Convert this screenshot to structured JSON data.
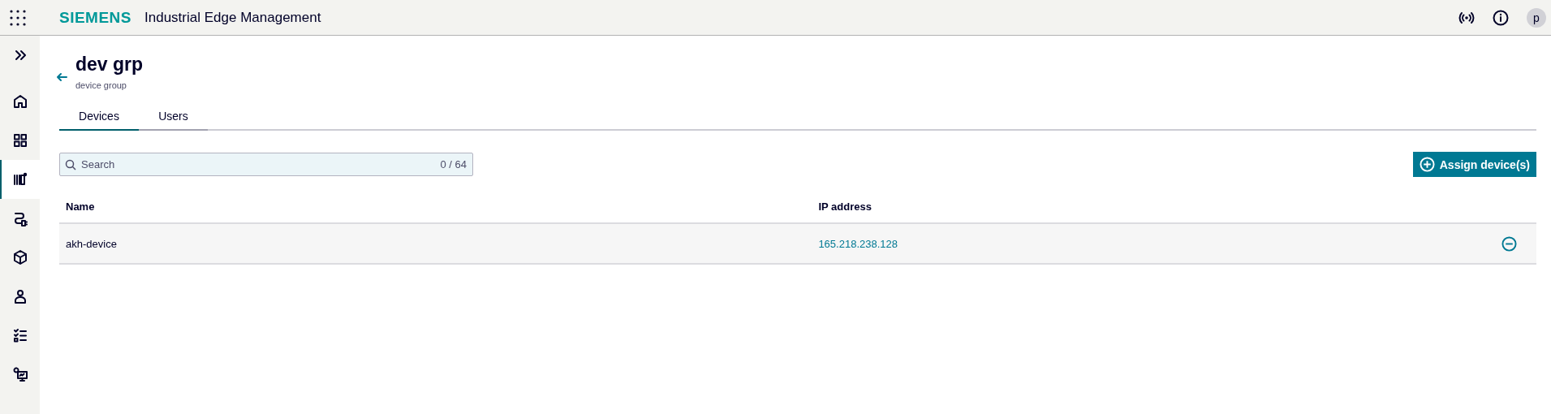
{
  "header": {
    "brand": "SIEMENS",
    "app_title": "Industrial Edge Management",
    "avatar": "p"
  },
  "sidebar": {
    "items": [
      {
        "selected": false
      },
      {
        "selected": false
      },
      {
        "selected": true
      },
      {
        "selected": false
      },
      {
        "selected": false
      },
      {
        "selected": false
      },
      {
        "selected": false
      },
      {
        "selected": false
      }
    ]
  },
  "page": {
    "title": "dev grp",
    "subtitle": "device group"
  },
  "tabs": [
    {
      "label": "Devices",
      "selected": true
    },
    {
      "label": "Users",
      "selected": false
    }
  ],
  "search": {
    "placeholder": "Search",
    "count": "0 / 64"
  },
  "assign_button": "Assign device(s)",
  "table": {
    "columns": [
      "Name",
      "IP address"
    ],
    "rows": [
      {
        "name": "akh-device",
        "ip": "165.218.238.128"
      }
    ]
  }
}
